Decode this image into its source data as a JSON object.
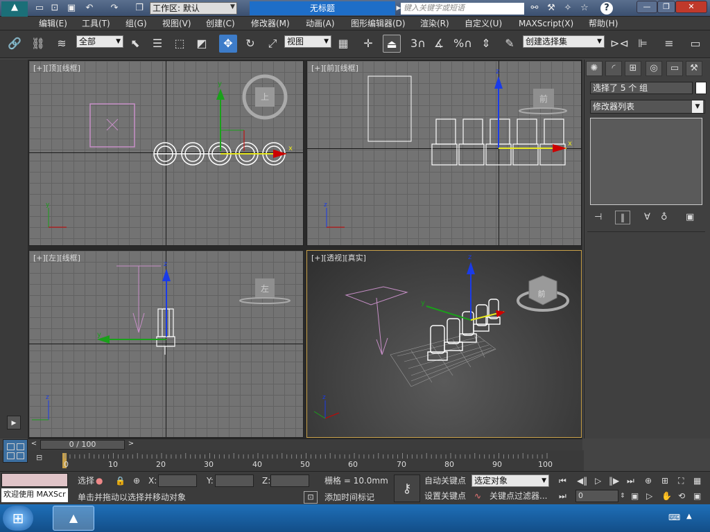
{
  "titlebar": {
    "workspace": "工作区: 默认",
    "title": "无标题",
    "search_placeholder": "键入关键字或短语"
  },
  "menu": [
    "编辑(E)",
    "工具(T)",
    "组(G)",
    "视图(V)",
    "创建(C)",
    "修改器(M)",
    "动画(A)",
    "图形编辑器(D)",
    "渲染(R)",
    "自定义(U)",
    "MAXScript(X)",
    "帮助(H)"
  ],
  "toolbar": {
    "filter": "全部",
    "coord": "视图",
    "selset": "创建选择集",
    "snap3": "3",
    "snap_pct": "%"
  },
  "viewports": {
    "top": {
      "label": "[+][顶][线框]",
      "cube": "上"
    },
    "front": {
      "label": "[+][前][线框]",
      "cube": "前"
    },
    "left": {
      "label": "[+][左][线框]",
      "cube": "左"
    },
    "persp": {
      "label": "[+][透视][真实]",
      "cube": "前"
    }
  },
  "axis": {
    "x": "x",
    "y": "y",
    "z": "z"
  },
  "cmdpanel": {
    "selection": "选择了 5 个 组",
    "modlist": "修改器列表"
  },
  "timebar": {
    "frame": "0 / 100"
  },
  "trackbar": {
    "ticks": [
      "0",
      "10",
      "20",
      "30",
      "40",
      "50",
      "60",
      "70",
      "80",
      "90",
      "100"
    ]
  },
  "status": {
    "welcome": "欢迎使用 MAXScr",
    "sel_label": "选择",
    "x": "X:",
    "y": "Y:",
    "z": "Z:",
    "grid": "栅格 = 10.0mm",
    "hint": "单击并拖动以选择并移动对象",
    "add_time_tag": "添加时间标记",
    "auto_key": "自动关键点",
    "set_key": "设置关键点",
    "sel_obj": "选定对象",
    "key_filter": "关键点过滤器...",
    "frame_field": "0"
  },
  "colors": {
    "accent": "#3d7cc9",
    "title_bg": "#1e6ec8",
    "persp_border": "#caa24a",
    "selection_yellow": "#e8e820"
  }
}
